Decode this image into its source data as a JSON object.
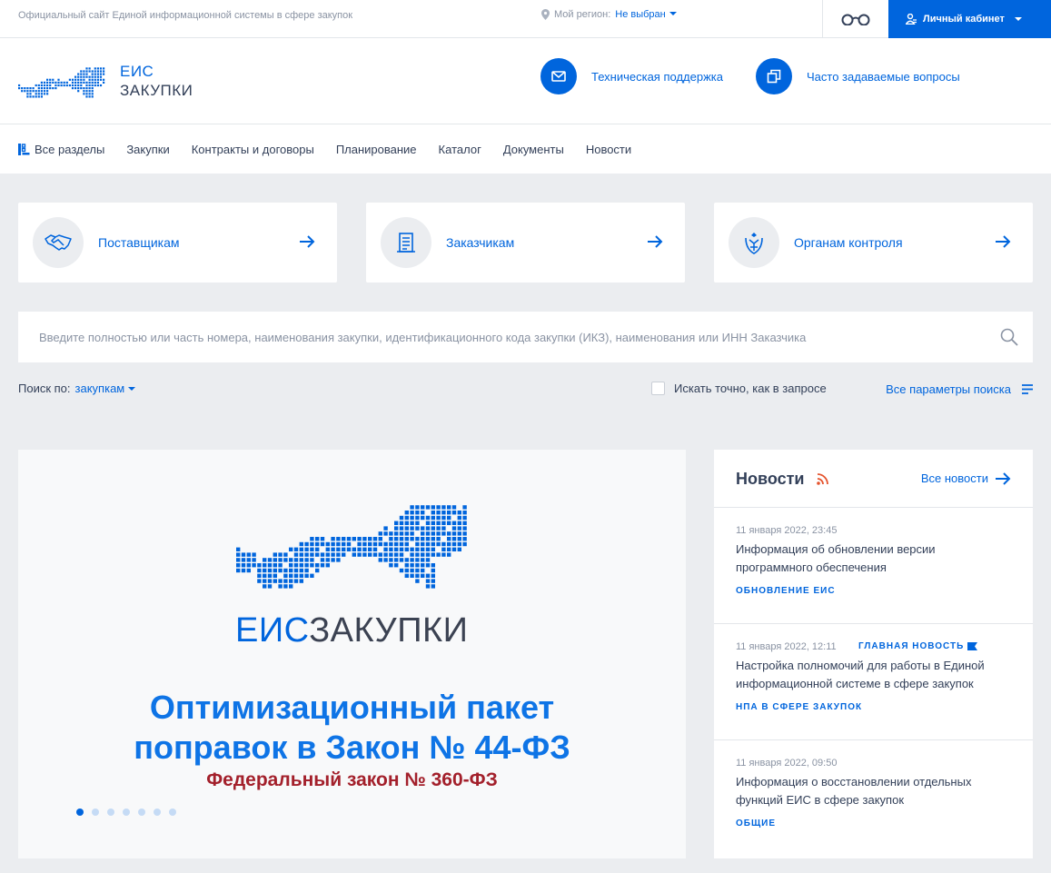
{
  "topbar": {
    "site_text": "Официальный сайт Единой информационной системы в сфере закупок",
    "region_label": "Мой регион:",
    "region_value": "Не выбран",
    "cabinet_label": "Личный кабинет"
  },
  "header": {
    "logo_line1": "ЕИС",
    "logo_line2": "ЗАКУПКИ",
    "support_label": "Техническая поддержка",
    "faq_label": "Часто задаваемые вопросы"
  },
  "nav": {
    "items": [
      "Все разделы",
      "Закупки",
      "Контракты и договоры",
      "Планирование",
      "Каталог",
      "Документы",
      "Новости"
    ]
  },
  "cards": [
    {
      "label": "Поставщикам",
      "icon": "handshake-icon"
    },
    {
      "label": "Заказчикам",
      "icon": "document-icon"
    },
    {
      "label": "Органам контроля",
      "icon": "emblem-icon"
    }
  ],
  "search": {
    "placeholder": "Введите полностью или часть номера, наименования закупки, идентификационного кода закупки (ИКЗ), наименования или ИНН Заказчика"
  },
  "search_options": {
    "by_label": "Поиск по:",
    "by_value": "закупкам",
    "exact_label": "Искать точно, как в запросе",
    "all_params_label": "Все параметры поиска"
  },
  "banner": {
    "brand_a": "ЕИС",
    "brand_b": "ЗАКУПКИ",
    "headline_1": "Оптимизационный пакет",
    "headline_2": "поправок в Закон № 44-ФЗ",
    "subline": "Федеральный закон № 360-ФЗ",
    "slides_total": 7,
    "active_slide": 1
  },
  "news": {
    "title": "Новости",
    "all_label": "Все новости",
    "items": [
      {
        "date": "11 января 2022, 23:45",
        "title": "Информация об обновлении версии программного обеспечения",
        "tag": "ОБНОВЛЕНИЕ ЕИС",
        "main": ""
      },
      {
        "date": "11 января 2022, 12:11",
        "title": "Настройка полномочий для работы в Единой информационной системе в сфере закупок",
        "tag": "НПА В СФЕРЕ ЗАКУПОК",
        "main": "ГЛАВНАЯ НОВОСТЬ"
      },
      {
        "date": "11 января 2022, 09:50",
        "title": "Информация о восстановлении отдельных функций ЕИС в сфере закупок",
        "tag": "ОБЩИЕ",
        "main": ""
      }
    ]
  },
  "colors": {
    "accent": "#0065dd",
    "headline": "#0e74e6",
    "subline": "#a3202b"
  }
}
